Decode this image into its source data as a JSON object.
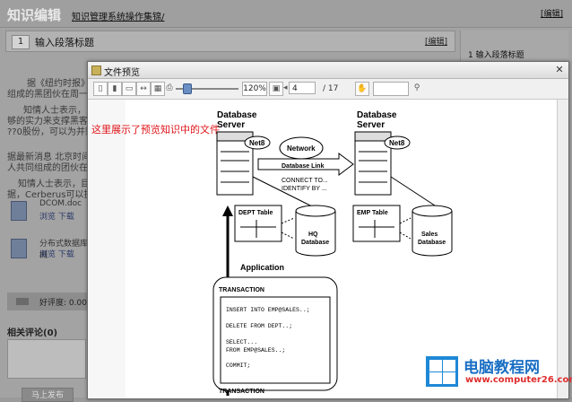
{
  "background": {
    "title": "知识编辑",
    "breadcrumb": "知识管理系统操作集锦/",
    "top_edit": "编辑",
    "section_number": "1",
    "section_title": "输入段落标题",
    "section_edit": "编辑",
    "sidebar_item": "1  输入段落标题",
    "paragraphs": [
      "据《纽约时报》报",
      "组成的黑团伙在周一的",
      "知情人士表示，目前",
      "够的实力来支撑黑客的",
      "??0股份，可以为并购的",
      "据最新消息 北京时间11月",
      "人共同组成的团伙在周一",
      "知情人士表示，目前迫",
      "据，Cerberus可以提供现金"
    ],
    "files": [
      {
        "name": "DCOM.doc",
        "actions": "浏览  下载"
      },
      {
        "name": "分布式数据库概",
        "actions": "浏览  下载"
      }
    ],
    "rating_text": "好评度: 0.00",
    "comments_label": "相关评论(0)",
    "submit_label": "马上发布"
  },
  "dialog": {
    "title": "文件预览",
    "close_glyph": "✕",
    "zoom": "120%",
    "page_current": "4",
    "page_total": "/   17",
    "annotation": "这里展示了预览知识中的文件"
  },
  "document": {
    "left_server": [
      "Database",
      "Server"
    ],
    "right_server": [
      "Database",
      "Server"
    ],
    "net8_left": "Net8",
    "net8_right": "Net8",
    "network": "Network",
    "database_link": "Database Link",
    "connect": [
      "CONNECT TO...",
      "IDENTIFY BY ..."
    ],
    "dept_table": "DEPT Table",
    "emp_table": "EMP Table",
    "hq_db": [
      "HQ",
      "Database"
    ],
    "sales_db": [
      "Sales",
      "Database"
    ],
    "application": "Application",
    "transaction": "TRANSACTION",
    "sql": [
      "INSERT INTO EMP@SALES..;",
      "DELETE FROM DEPT..;",
      "SELECT...",
      "  FROM EMP@SALES..;",
      "COMMIT;"
    ],
    "transaction2": "TRANSACTION"
  },
  "watermark": {
    "brand": "电脑教程网",
    "url": "www.computer26.com"
  }
}
